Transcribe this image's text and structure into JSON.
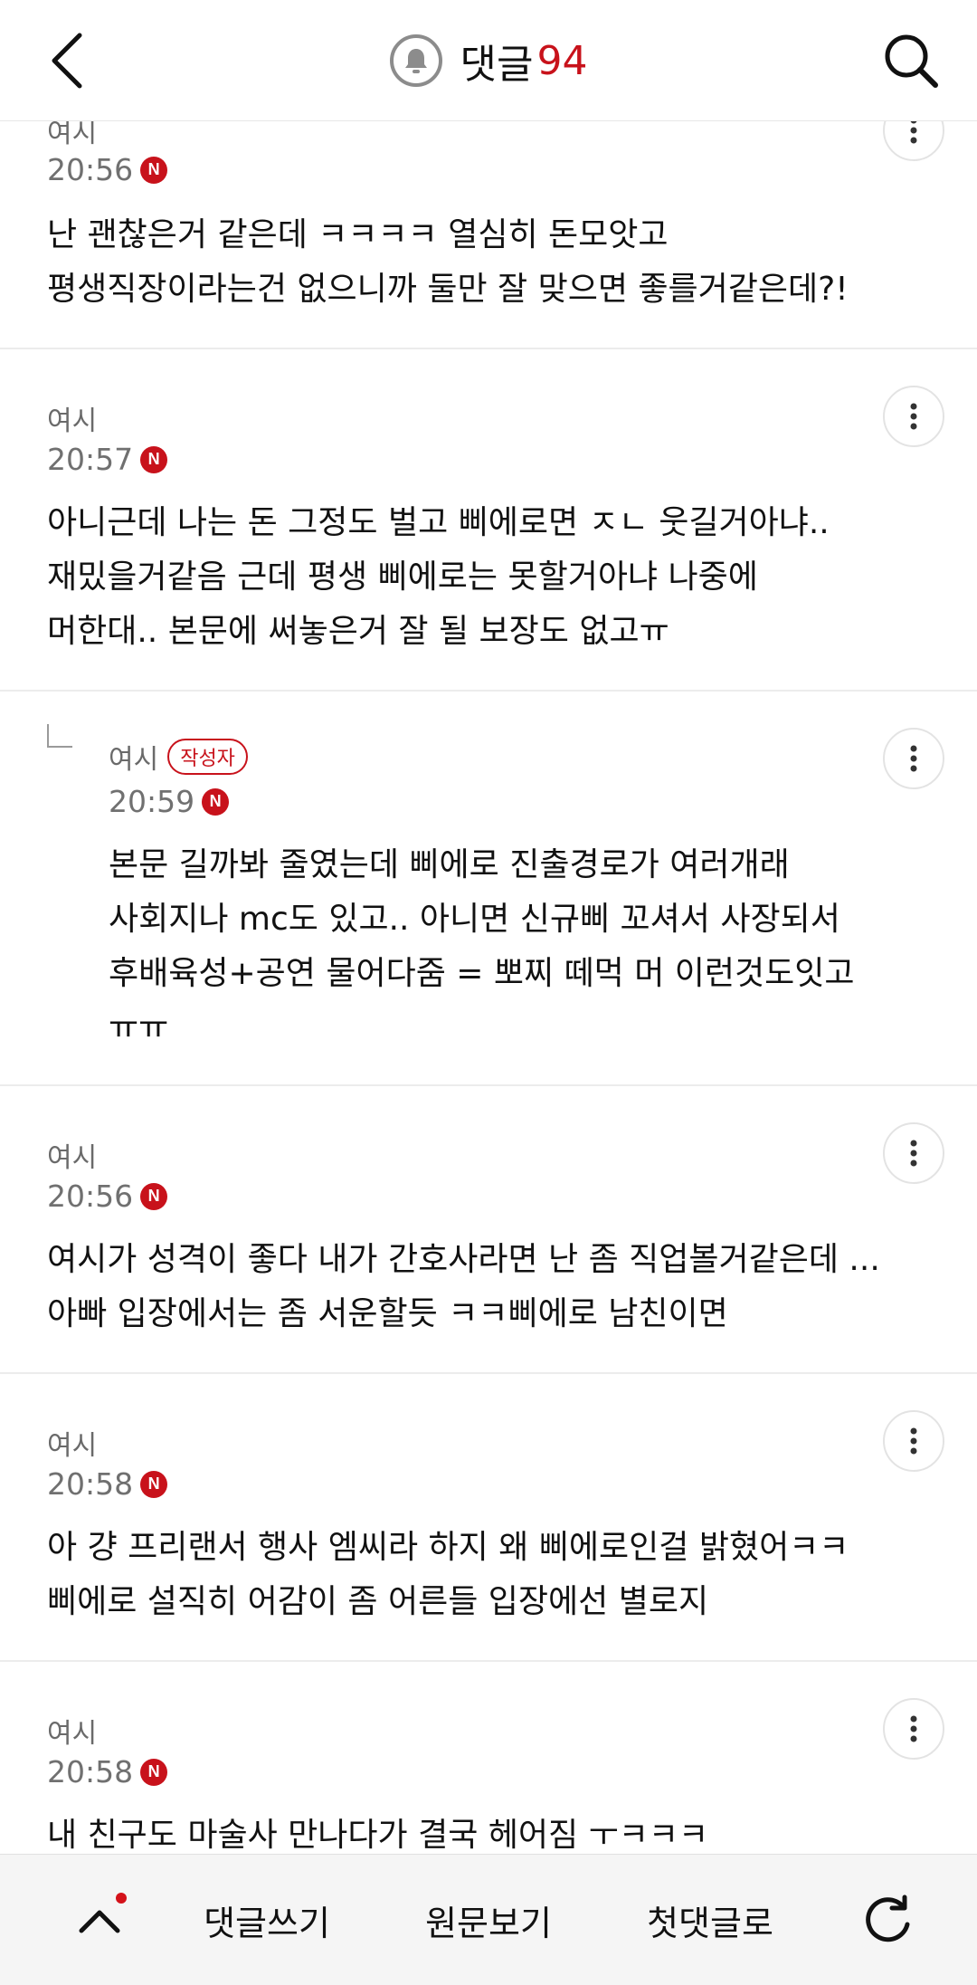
{
  "header": {
    "title": "댓글",
    "count": "94",
    "back_icon": "chevron-left-icon",
    "search_icon": "search-icon",
    "bell_icon": "bell-icon",
    "accent_color": "#c8121b"
  },
  "comments": [
    {
      "author": "여시",
      "time": "20:56",
      "new_badge": "N",
      "body": "난 괜찮은거 같은데 ㅋㅋㅋㅋ 열심히 돈모앗고\n평생직장이라는건 없으니까 둘만 잘 맞으면 좋를거같은데?!",
      "is_reply": false
    },
    {
      "author": "여시",
      "time": "20:57",
      "new_badge": "N",
      "body": "아니근데 나는 돈 그정도 벌고 삐에로면 ㅈㄴ 웃길거아냐..\n재밌을거같음 근데 평생 삐에로는 못할거아냐 나중에\n머한대.. 본문에 써놓은거 잘 될 보장도 없고ㅠ",
      "is_reply": false
    },
    {
      "author": "여시",
      "author_badge": "작성자",
      "time": "20:59",
      "new_badge": "N",
      "body": "본문 길까봐 줄였는데 삐에로 진출경로가 여러개래\n사회지나 mc도 있고.. 아니면 신규삐 꼬셔서 사장되서\n후배육성+공연 물어다줌 = 뽀찌 떼먹 머 이런것도잇고\nㅠㅠ",
      "is_reply": true
    },
    {
      "author": "여시",
      "time": "20:56",
      "new_badge": "N",
      "body": "여시가 성격이 좋다 내가 간호사라면 난 좀 직업볼거같은데 ...\n아빠 입장에서는 좀 서운할듯 ㅋㅋ삐에로 남친이면",
      "is_reply": false
    },
    {
      "author": "여시",
      "time": "20:58",
      "new_badge": "N",
      "body": "아 걍 프리랜서 행사 엠씨라 하지 왜 삐에로인걸 밝혔어ㅋㅋ\n삐에로 설직히 어감이 좀 어른들 입장에선 별로지",
      "is_reply": false
    },
    {
      "author": "여시",
      "time": "20:58",
      "new_badge": "N",
      "body": "내 친구도 마술사 만나다가 결국 헤어짐 ㅜㅋㅋㅋ",
      "is_reply": false
    }
  ],
  "bottom_bar": {
    "up_icon": "chevron-up-icon",
    "write_label": "댓글쓰기",
    "original_label": "원문보기",
    "first_comment_label": "첫댓글로",
    "refresh_icon": "refresh-icon"
  }
}
